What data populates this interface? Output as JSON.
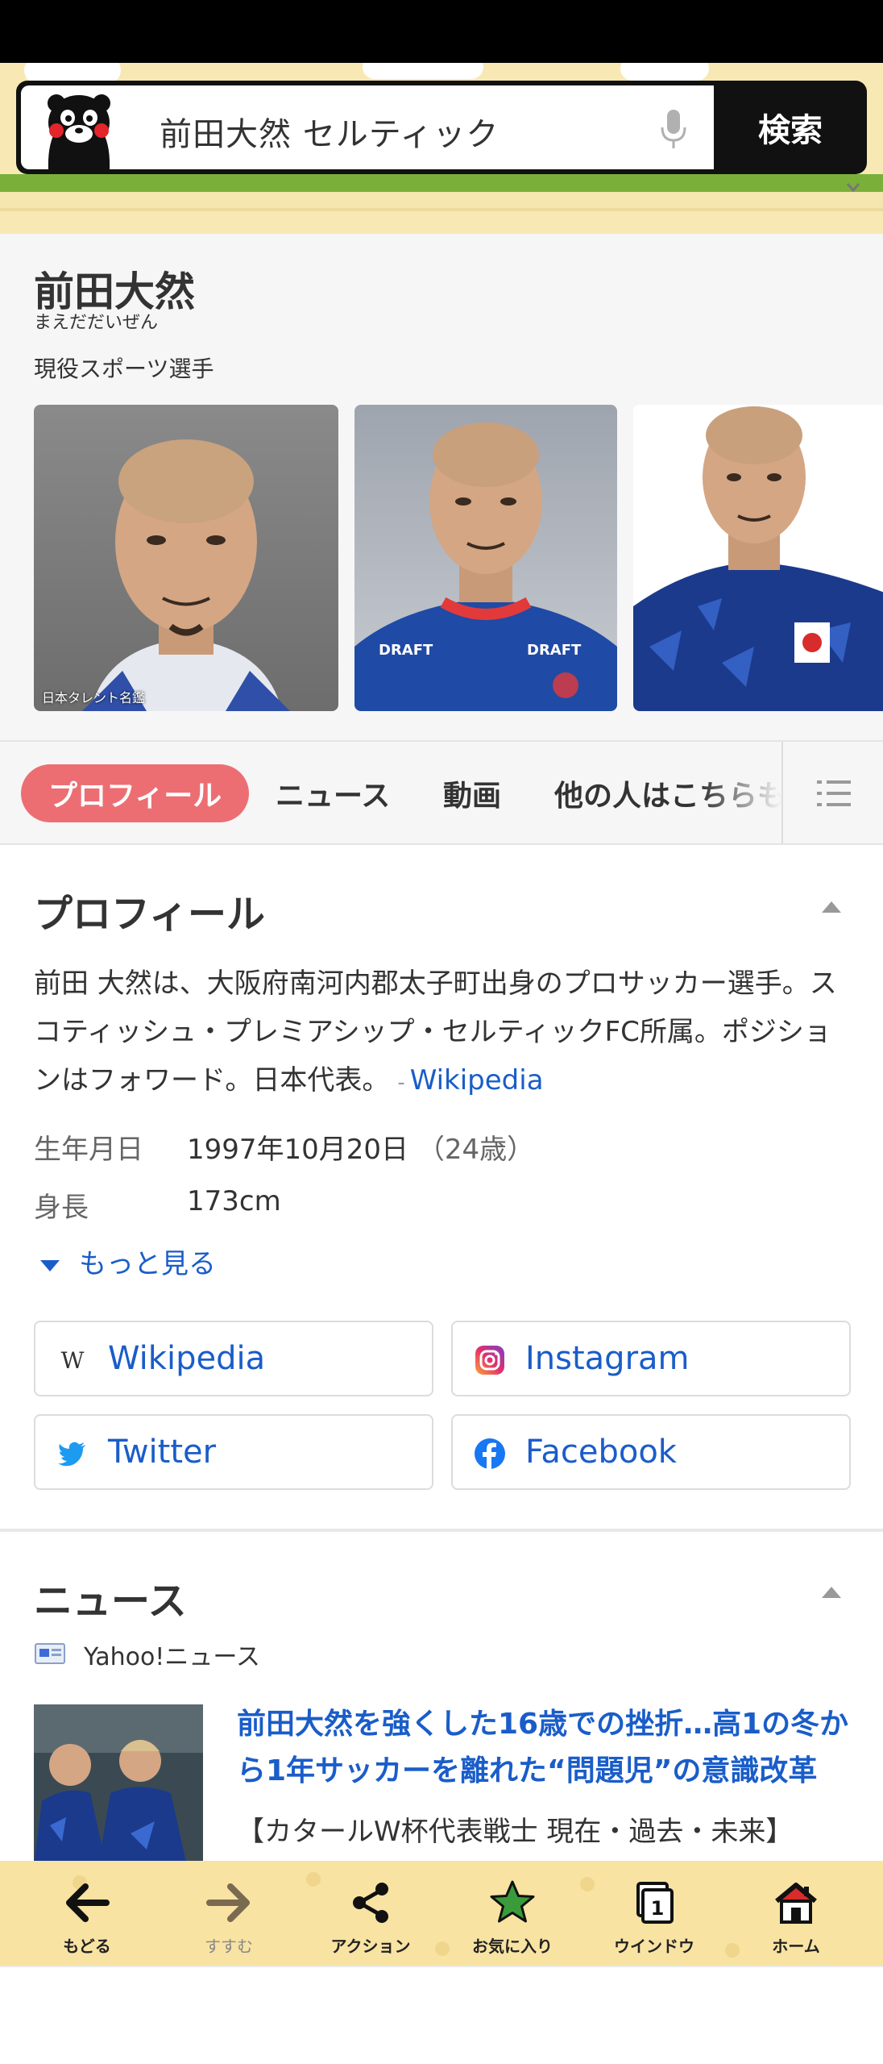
{
  "search": {
    "query": "前田大然 セルティック",
    "button_label": "検索"
  },
  "knowledge_panel": {
    "name": "前田大然",
    "reading": "まえだだいぜん",
    "description": "現役スポーツ選手",
    "photo_caption": "日本タレント名鑑"
  },
  "tabs": [
    {
      "label": "プロフィール",
      "active": true
    },
    {
      "label": "ニュース"
    },
    {
      "label": "動画"
    },
    {
      "label": "他の人はこちらも"
    }
  ],
  "profile": {
    "title": "プロフィール",
    "summary": "前田 大然は、大阪府南河内郡太子町出身のプロサッカー選手。スコティッシュ・プレミアシップ・セルティックFC所属。ポジションはフォワード。日本代表。",
    "source_link": "Wikipedia",
    "birthdate_label": "生年月日",
    "birthdate_value": "1997年10月20日",
    "age": "（24歳）",
    "height_label": "身長",
    "height_value": "173cm",
    "more_label": "もっと見る"
  },
  "links": [
    {
      "label": "Wikipedia",
      "icon": "wikipedia-icon"
    },
    {
      "label": "Instagram",
      "icon": "instagram-icon"
    },
    {
      "label": "Twitter",
      "icon": "twitter-icon"
    },
    {
      "label": "Facebook",
      "icon": "facebook-icon"
    }
  ],
  "news": {
    "title": "ニュース",
    "source": "Yahoo!ニュース",
    "headline": "前田大然を強くした16歳での挫折…高1の冬から1年サッカーを離れた“問題児”の意識改革",
    "subline": "【カタールW杯代表戦士 現在・過去・未来】"
  },
  "bottom_nav": [
    {
      "label": "もどる",
      "icon": "back-arrow-icon"
    },
    {
      "label": "すすむ",
      "icon": "forward-arrow-icon"
    },
    {
      "label": "アクション",
      "icon": "share-icon"
    },
    {
      "label": "お気に入り",
      "icon": "star-icon"
    },
    {
      "label": "ウインドウ",
      "icon": "window-icon",
      "count": "1"
    },
    {
      "label": "ホーム",
      "icon": "home-icon"
    }
  ],
  "colors": {
    "accent_tab": "#ec6e73",
    "link_blue": "#1a5dc9",
    "header_bg": "#f8e8b4",
    "grass": "#7ab03a"
  }
}
